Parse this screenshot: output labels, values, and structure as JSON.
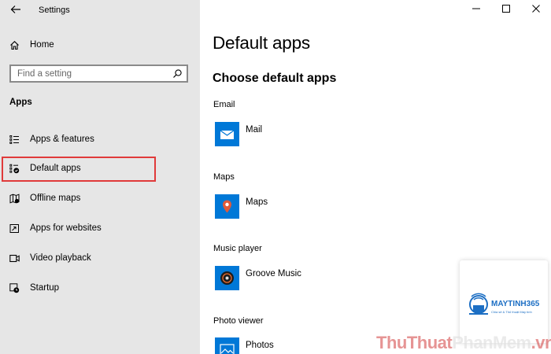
{
  "window": {
    "title": "Settings"
  },
  "sidebar": {
    "home_label": "Home",
    "search": {
      "placeholder": "Find a setting",
      "value": ""
    },
    "section_heading": "Apps",
    "items": [
      {
        "label": "Apps & features",
        "icon": "list-icon",
        "selected": false
      },
      {
        "label": "Default apps",
        "icon": "default-apps-icon",
        "selected": true
      },
      {
        "label": "Offline maps",
        "icon": "map-icon",
        "selected": false
      },
      {
        "label": "Apps for websites",
        "icon": "open-in-new-icon",
        "selected": false
      },
      {
        "label": "Video playback",
        "icon": "video-icon",
        "selected": false
      },
      {
        "label": "Startup",
        "icon": "startup-icon",
        "selected": false
      }
    ],
    "selection_outline_color": "#e03a3a"
  },
  "main": {
    "title": "Default apps",
    "subtitle": "Choose default apps",
    "categories": [
      {
        "label": "Email",
        "app": "Mail",
        "icon": "mail-icon"
      },
      {
        "label": "Maps",
        "app": "Maps",
        "icon": "map-pin-icon"
      },
      {
        "label": "Music player",
        "app": "Groove Music",
        "icon": "music-disc-icon"
      },
      {
        "label": "Photo viewer",
        "app": "Photos",
        "icon": "photo-icon"
      }
    ],
    "app_tile_color": "#0078d7"
  },
  "watermarks": {
    "logo_name": "MAYTINH365",
    "logo_tagline": "Chia sẻ & Thủ thuật Máy tính",
    "site_part1": "ThuThuat",
    "site_part2": "PhanMem",
    "site_part3": ".vn"
  }
}
